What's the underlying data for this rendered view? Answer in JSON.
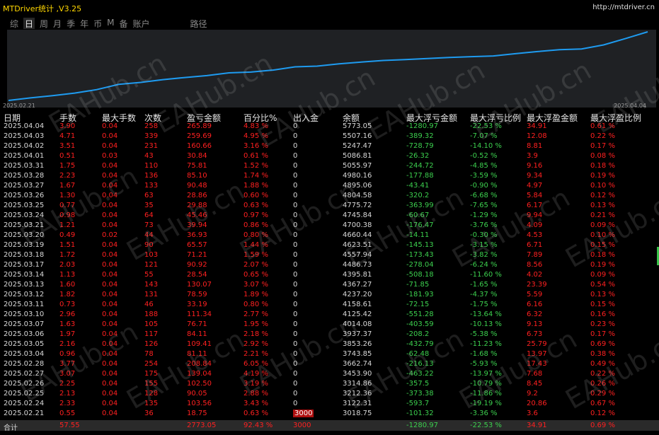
{
  "app": {
    "title": "MTDriver统计 ,V3.25",
    "url": "http://mtdriver.cn"
  },
  "tabs": [
    {
      "label": "综",
      "active": false
    },
    {
      "label": "日",
      "active": true
    },
    {
      "label": "周",
      "active": false
    },
    {
      "label": "月",
      "active": false
    },
    {
      "label": "季",
      "active": false
    },
    {
      "label": "年",
      "active": false
    },
    {
      "label": "币",
      "active": false
    },
    {
      "label": "M",
      "active": false
    },
    {
      "label": "备",
      "active": false
    },
    {
      "label": "账户",
      "active": false
    },
    {
      "label": "路径",
      "active": false
    }
  ],
  "chart": {
    "start_label": "2025.02.21",
    "end_label": "2025.04.04",
    "line_color": "#1e9bf0",
    "balance": [
      3018.75,
      3122.31,
      3212.36,
      3314.86,
      3453.9,
      3662.74,
      3743.85,
      3853.26,
      3937.37,
      4014.08,
      4125.42,
      4158.61,
      4237.2,
      4367.27,
      4395.81,
      4486.73,
      4557.94,
      4623.51,
      4660.44,
      4700.38,
      4745.84,
      4775.72,
      4804.58,
      4895.06,
      4980.16,
      5055.97,
      5086.81,
      5247.47,
      5507.16,
      5773.05
    ]
  },
  "watermark": "EAHub.cn",
  "columns": [
    "日期",
    "手数",
    "最大手数",
    "次数",
    "盈亏金额",
    "百分比%",
    "出入金",
    "余额",
    "最大浮亏金额",
    "最大浮亏比例",
    "最大浮盈金额",
    "最大浮盈比例"
  ],
  "rows": [
    [
      "2025.04.04",
      "3.90",
      "0.04",
      "258",
      "265.89",
      "4.83 %",
      "0",
      "5773.05",
      "-1280.97",
      "-22.53 %",
      "34.91",
      "0.61 %"
    ],
    [
      "2025.04.03",
      "4.71",
      "0.04",
      "339",
      "259.69",
      "4.95 %",
      "0",
      "5507.16",
      "-389.32",
      "-7.07 %",
      "12.08",
      "0.22 %"
    ],
    [
      "2025.04.02",
      "3.51",
      "0.04",
      "231",
      "160.66",
      "3.16 %",
      "0",
      "5247.47",
      "-728.79",
      "-14.10 %",
      "8.81",
      "0.17 %"
    ],
    [
      "2025.04.01",
      "0.51",
      "0.03",
      "43",
      "30.84",
      "0.61 %",
      "0",
      "5086.81",
      "-26.32",
      "-0.52 %",
      "3.9",
      "0.08 %"
    ],
    [
      "2025.03.31",
      "1.75",
      "0.04",
      "110",
      "75.81",
      "1.52 %",
      "0",
      "5055.97",
      "-244.72",
      "-4.85 %",
      "9.16",
      "0.18 %"
    ],
    [
      "2025.03.28",
      "2.23",
      "0.04",
      "136",
      "85.10",
      "1.74 %",
      "0",
      "4980.16",
      "-177.88",
      "-3.59 %",
      "9.34",
      "0.19 %"
    ],
    [
      "2025.03.27",
      "1.67",
      "0.04",
      "133",
      "90.48",
      "1.88 %",
      "0",
      "4895.06",
      "-43.41",
      "-0.90 %",
      "4.97",
      "0.10 %"
    ],
    [
      "2025.03.26",
      "1.30",
      "0.04",
      "63",
      "28.86",
      "0.60 %",
      "0",
      "4804.58",
      "-320.2",
      "-6.68 %",
      "5.84",
      "0.12 %"
    ],
    [
      "2025.03.25",
      "0.77",
      "0.04",
      "35",
      "29.88",
      "0.63 %",
      "0",
      "4775.72",
      "-363.99",
      "-7.65 %",
      "6.17",
      "0.13 %"
    ],
    [
      "2025.03.24",
      "0.98",
      "0.04",
      "64",
      "45.46",
      "0.97 %",
      "0",
      "4745.84",
      "-60.67",
      "-1.29 %",
      "9.94",
      "0.21 %"
    ],
    [
      "2025.03.21",
      "1.21",
      "0.04",
      "73",
      "39.94",
      "0.86 %",
      "0",
      "4700.38",
      "-176.47",
      "-3.76 %",
      "4.09",
      "0.09 %"
    ],
    [
      "2025.03.20",
      "0.49",
      "0.02",
      "44",
      "36.93",
      "0.80 %",
      "0",
      "4660.44",
      "-14.11",
      "-0.30 %",
      "4.53",
      "0.10 %"
    ],
    [
      "2025.03.19",
      "1.51",
      "0.04",
      "90",
      "65.57",
      "1.44 %",
      "0",
      "4623.51",
      "-145.13",
      "-3.15 %",
      "6.71",
      "0.15 %"
    ],
    [
      "2025.03.18",
      "1.72",
      "0.04",
      "103",
      "71.21",
      "1.59 %",
      "0",
      "4557.94",
      "-173.43",
      "-3.82 %",
      "7.89",
      "0.18 %"
    ],
    [
      "2025.03.17",
      "2.03",
      "0.04",
      "121",
      "90.92",
      "2.07 %",
      "0",
      "4486.73",
      "-278.04",
      "-6.24 %",
      "8.56",
      "0.19 %"
    ],
    [
      "2025.03.14",
      "1.13",
      "0.04",
      "55",
      "28.54",
      "0.65 %",
      "0",
      "4395.81",
      "-508.18",
      "-11.60 %",
      "4.02",
      "0.09 %"
    ],
    [
      "2025.03.13",
      "1.60",
      "0.04",
      "143",
      "130.07",
      "3.07 %",
      "0",
      "4367.27",
      "-71.85",
      "-1.65 %",
      "23.39",
      "0.54 %"
    ],
    [
      "2025.03.12",
      "1.82",
      "0.04",
      "131",
      "78.59",
      "1.89 %",
      "0",
      "4237.20",
      "-181.93",
      "-4.37 %",
      "5.59",
      "0.13 %"
    ],
    [
      "2025.03.11",
      "0.73",
      "0.04",
      "46",
      "33.19",
      "0.80 %",
      "0",
      "4158.61",
      "-72.15",
      "-1.75 %",
      "6.16",
      "0.15 %"
    ],
    [
      "2025.03.10",
      "2.96",
      "0.04",
      "188",
      "111.34",
      "2.77 %",
      "0",
      "4125.42",
      "-551.28",
      "-13.64 %",
      "6.32",
      "0.16 %"
    ],
    [
      "2025.03.07",
      "1.63",
      "0.04",
      "105",
      "76.71",
      "1.95 %",
      "0",
      "4014.08",
      "-403.59",
      "-10.13 %",
      "9.13",
      "0.23 %"
    ],
    [
      "2025.03.06",
      "1.97",
      "0.04",
      "117",
      "84.11",
      "2.18 %",
      "0",
      "3937.37",
      "-208.2",
      "-5.38 %",
      "6.73",
      "0.17 %"
    ],
    [
      "2025.03.05",
      "2.16",
      "0.04",
      "126",
      "109.41",
      "2.92 %",
      "0",
      "3853.26",
      "-432.79",
      "-11.23 %",
      "25.79",
      "0.69 %"
    ],
    [
      "2025.03.04",
      "0.96",
      "0.04",
      "78",
      "81.11",
      "2.21 %",
      "0",
      "3743.85",
      "-62.48",
      "-1.68 %",
      "13.97",
      "0.38 %"
    ],
    [
      "2025.02.28",
      "3.77",
      "0.04",
      "254",
      "208.84",
      "6.05 %",
      "0",
      "3662.74",
      "-216.13",
      "-5.93 %",
      "17.43",
      "0.49 %"
    ],
    [
      "2025.02.27",
      "3.07",
      "0.04",
      "175",
      "139.04",
      "4.19 %",
      "0",
      "3453.90",
      "-463.22",
      "-13.97 %",
      "7.68",
      "0.22 %"
    ],
    [
      "2025.02.26",
      "2.25",
      "0.04",
      "155",
      "102.50",
      "3.19 %",
      "0",
      "3314.86",
      "-357.5",
      "-10.79 %",
      "8.45",
      "0.26 %"
    ],
    [
      "2025.02.25",
      "2.13",
      "0.04",
      "128",
      "90.05",
      "2.88 %",
      "0",
      "3212.36",
      "-373.38",
      "-11.86 %",
      "9.2",
      "0.29 %"
    ],
    [
      "2025.02.24",
      "2.33",
      "0.04",
      "135",
      "103.56",
      "3.43 %",
      "0",
      "3122.31",
      "-593.7",
      "-19.19 %",
      "20.86",
      "0.67 %"
    ],
    [
      "2025.02.21",
      "0.55",
      "0.04",
      "36",
      "18.75",
      "0.63 %",
      "3000",
      "3018.75",
      "-101.32",
      "-3.36 %",
      "3.6",
      "0.12 %"
    ]
  ],
  "total": [
    "合计",
    "57.55",
    "",
    "",
    "2773.05",
    "92.43 %",
    "3000",
    "",
    "-1280.97",
    "-22.53 %",
    "34.91",
    "0.69 %"
  ]
}
